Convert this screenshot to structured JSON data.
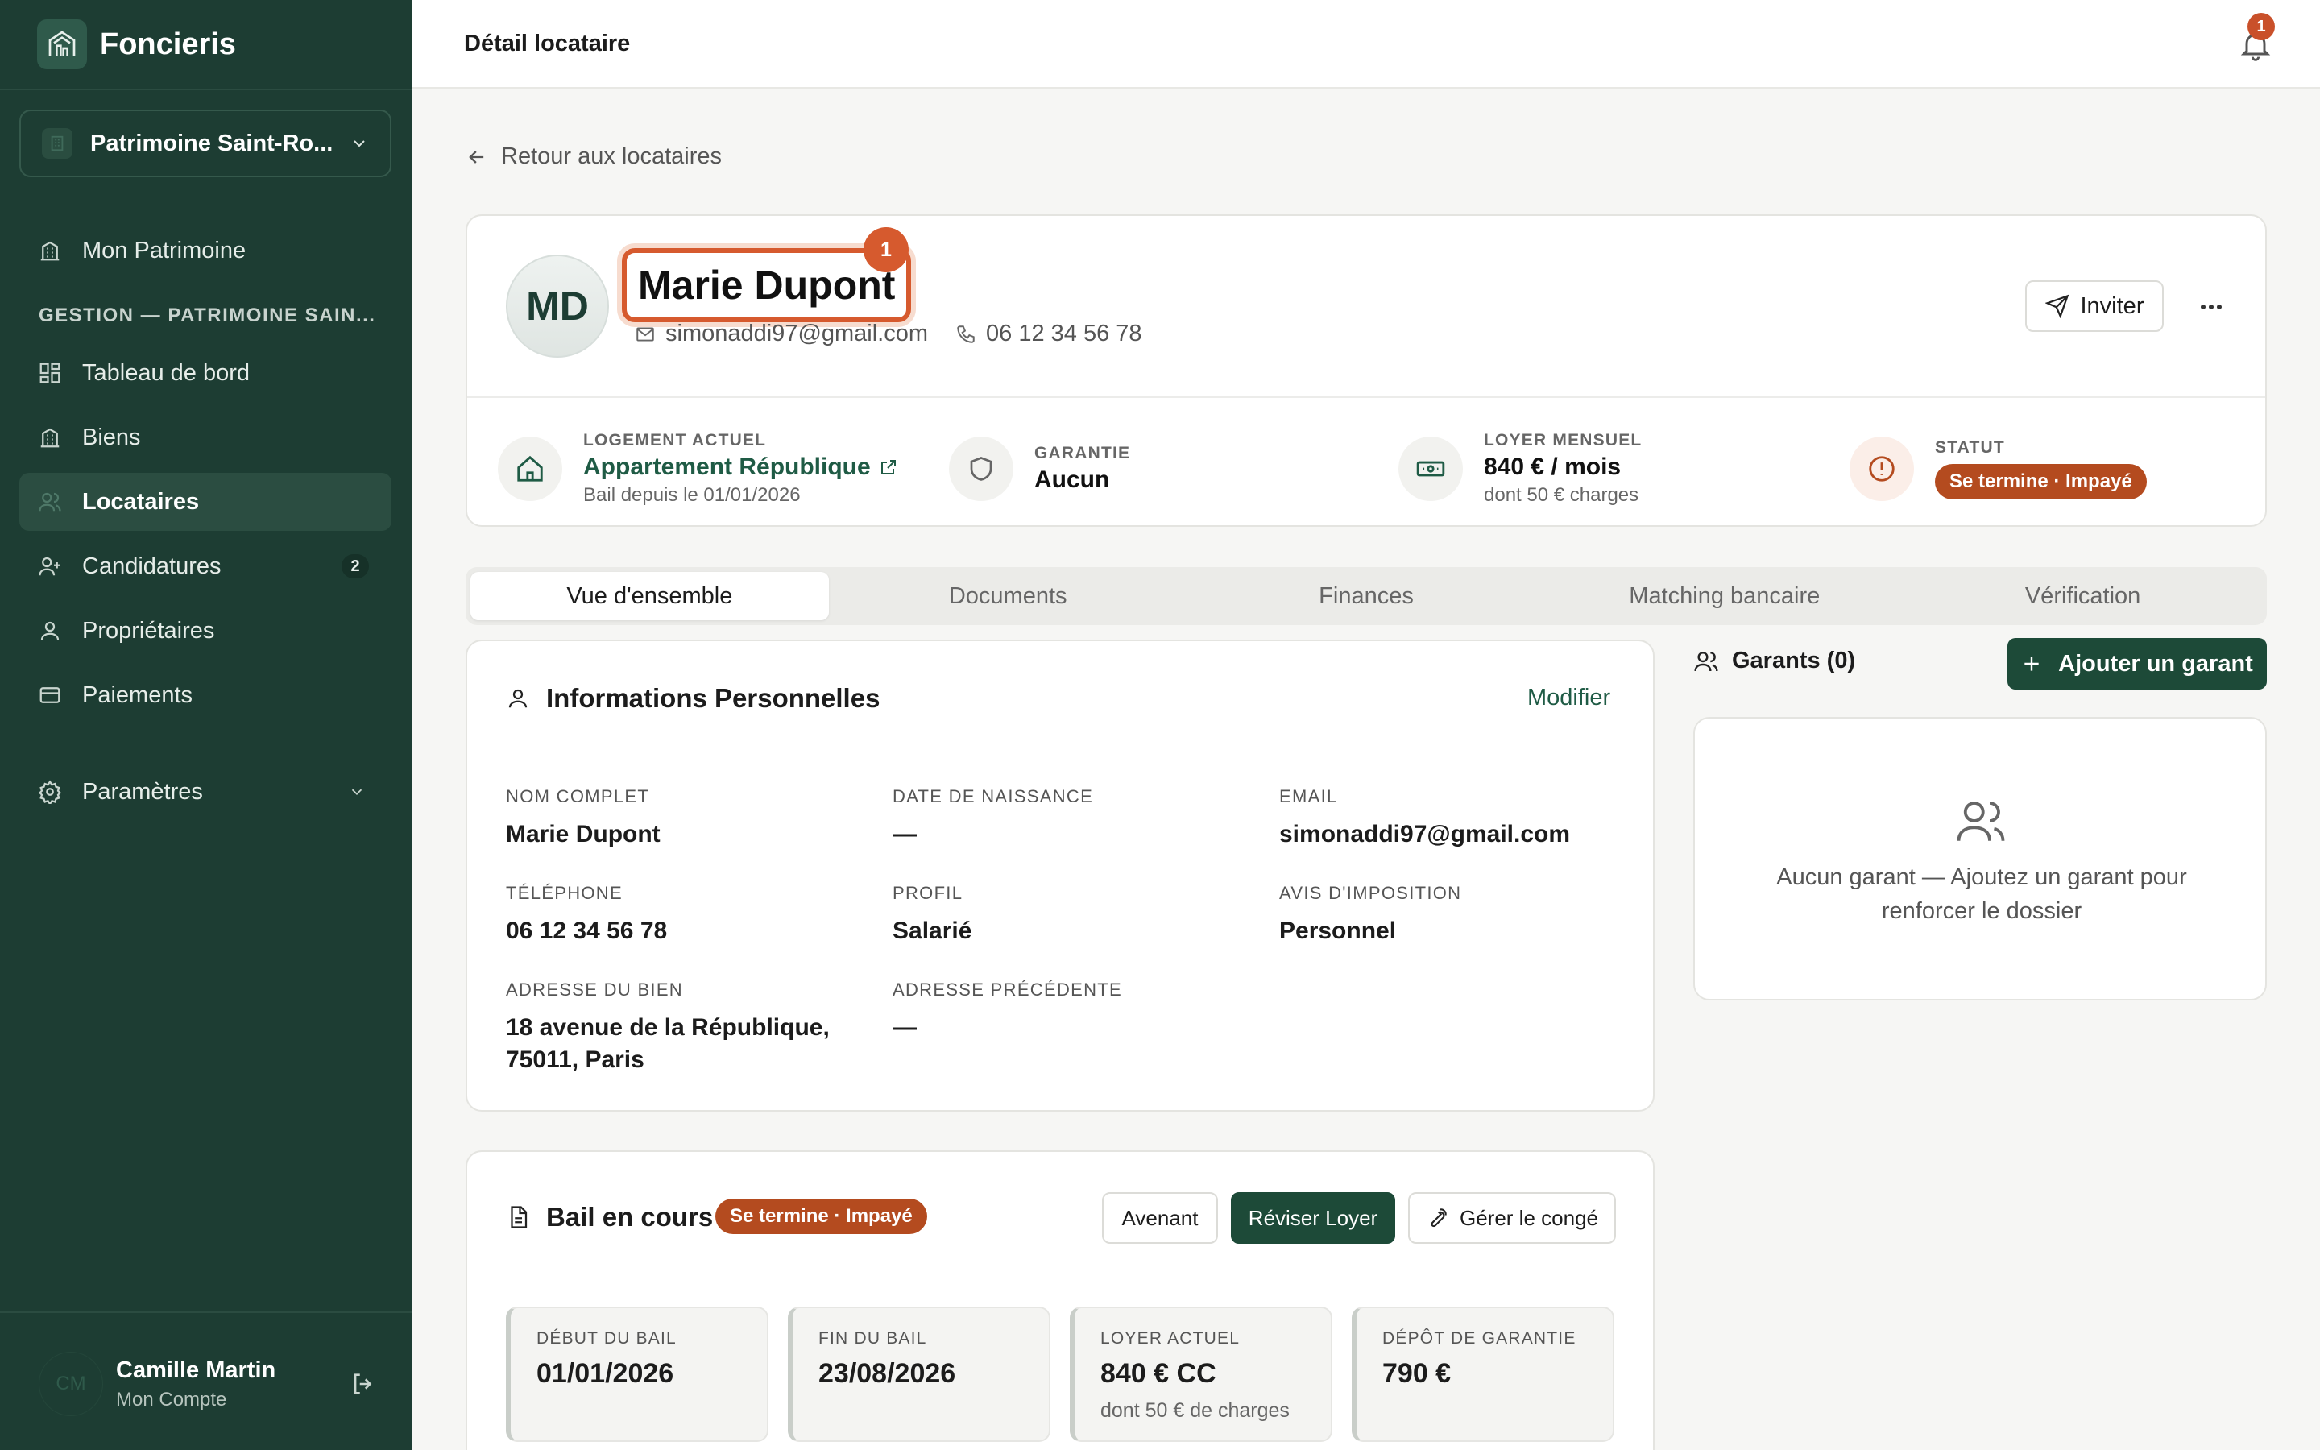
{
  "sidebar": {
    "brand": "Foncieris",
    "org": "Patrimoine Saint-Ro...",
    "nav_top": {
      "label": "Mon Patrimoine"
    },
    "section": "GESTION — PATRIMOINE SAIN...",
    "items": [
      {
        "label": "Tableau de bord",
        "icon": "dashboard-icon"
      },
      {
        "label": "Biens",
        "icon": "building-icon"
      },
      {
        "label": "Locataires",
        "icon": "users-icon",
        "active": true
      },
      {
        "label": "Candidatures",
        "icon": "user-plus-icon",
        "badge": "2"
      },
      {
        "label": "Propriétaires",
        "icon": "user-icon"
      },
      {
        "label": "Paiements",
        "icon": "card-icon"
      }
    ],
    "settings": "Paramètres",
    "user": {
      "initials": "CM",
      "name": "Camille Martin",
      "sub": "Mon Compte"
    }
  },
  "topbar": {
    "title": "Détail locataire",
    "notif_count": "1"
  },
  "back_label": "Retour aux locataires",
  "tenant": {
    "initials": "MD",
    "name": "Marie Dupont",
    "name_marker": "1",
    "email": "simonaddi97@gmail.com",
    "phone": "06 12 34 56 78",
    "invite_label": "Inviter"
  },
  "stats": {
    "logement": {
      "label": "LOGEMENT ACTUEL",
      "value": "Appartement République",
      "sub": "Bail depuis le 01/01/2026"
    },
    "garantie": {
      "label": "GARANTIE",
      "value": "Aucun"
    },
    "loyer": {
      "label": "LOYER MENSUEL",
      "value": "840 € / mois",
      "sub": "dont 50 € charges"
    },
    "statut": {
      "label": "STATUT",
      "value": "Se termine · Impayé"
    }
  },
  "tabs": [
    "Vue d'ensemble",
    "Documents",
    "Finances",
    "Matching bancaire",
    "Vérification"
  ],
  "info": {
    "title": "Informations Personnelles",
    "edit": "Modifier",
    "fields": {
      "nom": {
        "k": "NOM COMPLET",
        "v": "Marie Dupont"
      },
      "naissance": {
        "k": "DATE DE NAISSANCE",
        "v": "—"
      },
      "email": {
        "k": "EMAIL",
        "v": "simonaddi97@gmail.com"
      },
      "tel": {
        "k": "TÉLÉPHONE",
        "v": "06 12 34 56 78"
      },
      "profil": {
        "k": "PROFIL",
        "v": "Salarié"
      },
      "avis": {
        "k": "AVIS D'IMPOSITION",
        "v": "Personnel"
      },
      "adresse": {
        "k": "ADRESSE DU BIEN",
        "v1": "18 avenue de la République,",
        "v2": "75011, Paris"
      },
      "precedente": {
        "k": "ADRESSE PRÉCÉDENTE",
        "v": "—"
      }
    }
  },
  "guarantors": {
    "title": "Garants (0)",
    "add": "Ajouter un garant",
    "empty1": "Aucun garant — Ajoutez un garant pour",
    "empty2": "renforcer le dossier"
  },
  "lease": {
    "title": "Bail en cours",
    "status": "Se termine · Impayé",
    "btn_avenant": "Avenant",
    "btn_reviser": "Réviser Loyer",
    "btn_conge": "Gérer le congé",
    "debut": {
      "k": "DÉBUT DU BAIL",
      "v": "01/01/2026"
    },
    "fin": {
      "k": "FIN DU BAIL",
      "v": "23/08/2026"
    },
    "loyer": {
      "k": "LOYER ACTUEL",
      "v": "840 € CC",
      "s": "dont 50 € de charges"
    },
    "depot": {
      "k": "DÉPÔT DE GARANTIE",
      "v": "790 €"
    }
  },
  "colors": {
    "sidebar": "#1d3d33",
    "accent": "#1d4a38",
    "alert": "#b44b1f",
    "highlight": "#d65a2e"
  }
}
